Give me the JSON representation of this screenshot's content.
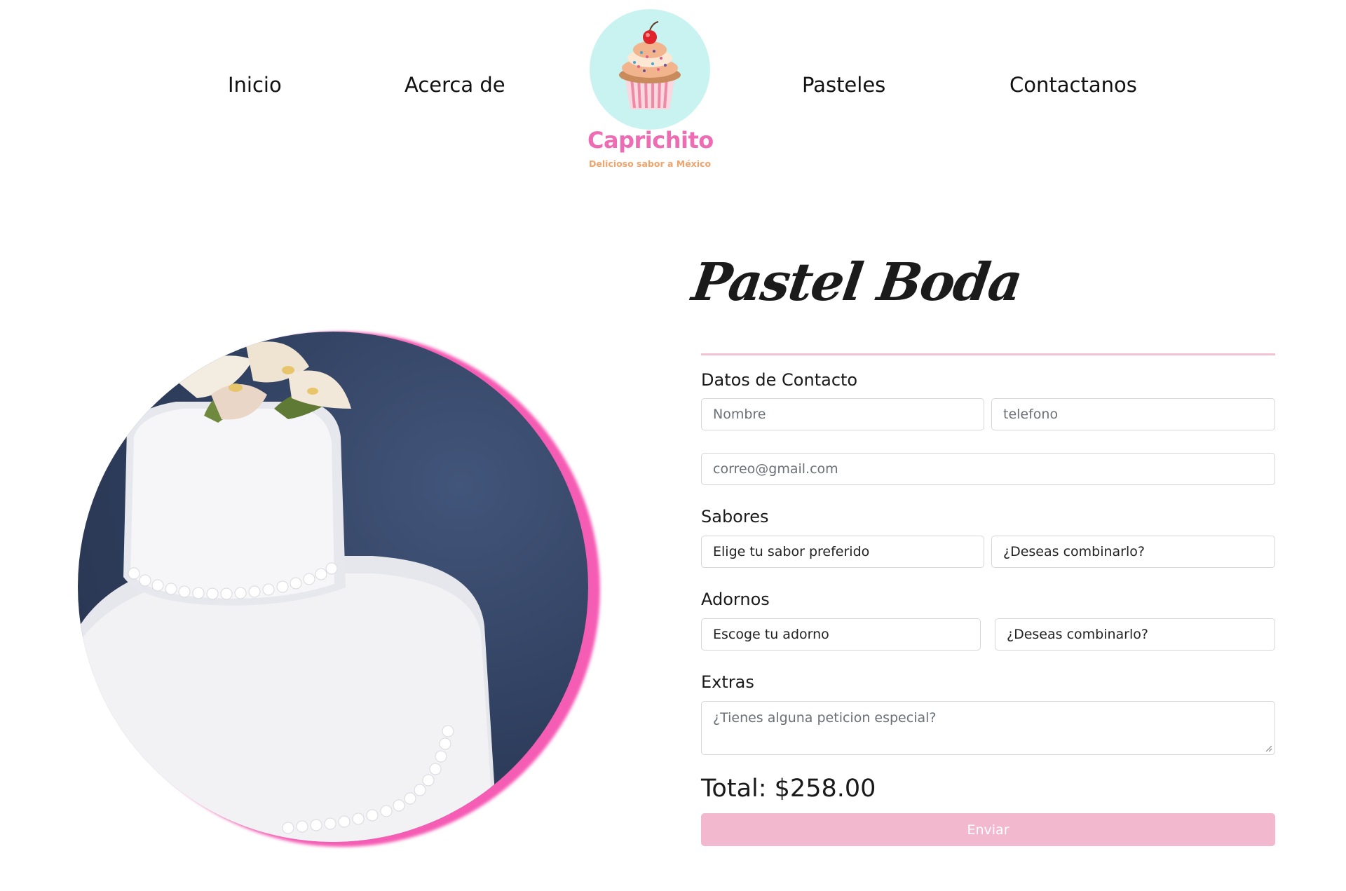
{
  "nav": {
    "items": [
      {
        "label": "Inicio"
      },
      {
        "label": "Acerca de"
      },
      {
        "label": "Pasteles"
      },
      {
        "label": "Contactanos"
      }
    ]
  },
  "logo": {
    "name": "Caprichito",
    "tagline": "Delicioso sabor a México",
    "icon": "cupcake-icon",
    "colors": {
      "circle": "#c9f3f1",
      "name": "#ee6cb3",
      "tagline": "#f0a36b"
    }
  },
  "product": {
    "title": "Pastel Boda",
    "image": "wedding-cake-photo"
  },
  "form": {
    "contact": {
      "label": "Datos de Contacto",
      "name_placeholder": "Nombre",
      "phone_placeholder": "telefono",
      "email_placeholder": "correo@gmail.com"
    },
    "flavors": {
      "label": "Sabores",
      "select_value": "Elige tu sabor preferido",
      "combine_value": "¿Deseas combinarlo?"
    },
    "decorations": {
      "label": "Adornos",
      "select_value": "Escoge tu adorno",
      "combine_value": "¿Deseas combinarlo?"
    },
    "extras": {
      "label": "Extras",
      "placeholder": "¿Tienes alguna peticion especial?"
    },
    "total": "Total: $258.00",
    "submit_label": "Enviar"
  },
  "colors": {
    "accent_pink": "#f2b8cd",
    "image_border": "#f55cb4",
    "divider": "#f3c1d3"
  }
}
